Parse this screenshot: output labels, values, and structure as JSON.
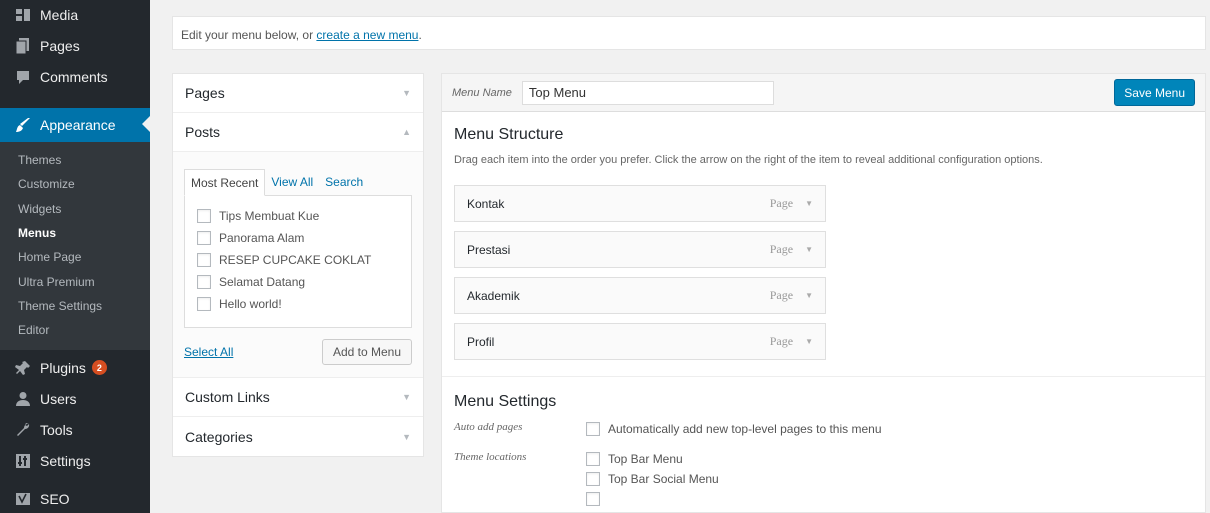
{
  "sidebar": {
    "top_items": [
      {
        "label": "Media",
        "icon": "media-icon"
      },
      {
        "label": "Pages",
        "icon": "pages-icon"
      },
      {
        "label": "Comments",
        "icon": "comments-icon"
      }
    ],
    "active": {
      "label": "Appearance",
      "icon": "paintbrush-icon"
    },
    "submenu": [
      "Themes",
      "Customize",
      "Widgets",
      "Menus",
      "Home Page",
      "Ultra Premium",
      "Theme Settings",
      "Editor"
    ],
    "current_sub": "Menus",
    "bottom_items": [
      {
        "label": "Plugins",
        "icon": "plugins-icon",
        "badge": "2"
      },
      {
        "label": "Users",
        "icon": "users-icon"
      },
      {
        "label": "Tools",
        "icon": "tools-icon"
      },
      {
        "label": "Settings",
        "icon": "settings-icon"
      },
      {
        "label": "SEO",
        "icon": "seo-icon"
      }
    ]
  },
  "notice": {
    "text": "Edit your menu below, or ",
    "link": "create a new menu",
    "suffix": "."
  },
  "accordion": {
    "pages": "Pages",
    "posts": "Posts",
    "tabs": [
      "Most Recent",
      "View All",
      "Search"
    ],
    "posts_list": [
      "Tips Membuat Kue",
      "Panorama Alam",
      "RESEP CUPCAKE COKLAT",
      "Selamat Datang",
      "Hello world!"
    ],
    "select_all": "Select All",
    "add_to_menu": "Add to Menu",
    "custom_links": "Custom Links",
    "categories": "Categories"
  },
  "menu": {
    "name_label": "Menu Name",
    "name_value": "Top Menu",
    "save": "Save Menu",
    "structure_title": "Menu Structure",
    "structure_desc": "Drag each item into the order you prefer. Click the arrow on the right of the item to reveal additional configuration options.",
    "items": [
      {
        "title": "Kontak",
        "type": "Page"
      },
      {
        "title": "Prestasi",
        "type": "Page"
      },
      {
        "title": "Akademik",
        "type": "Page"
      },
      {
        "title": "Profil",
        "type": "Page"
      }
    ],
    "settings_title": "Menu Settings",
    "auto_add_label": "Auto add pages",
    "auto_add_option": "Automatically add new top-level pages to this menu",
    "locations_label": "Theme locations",
    "locations": [
      "Top Bar Menu",
      "Top Bar Social Menu"
    ]
  }
}
